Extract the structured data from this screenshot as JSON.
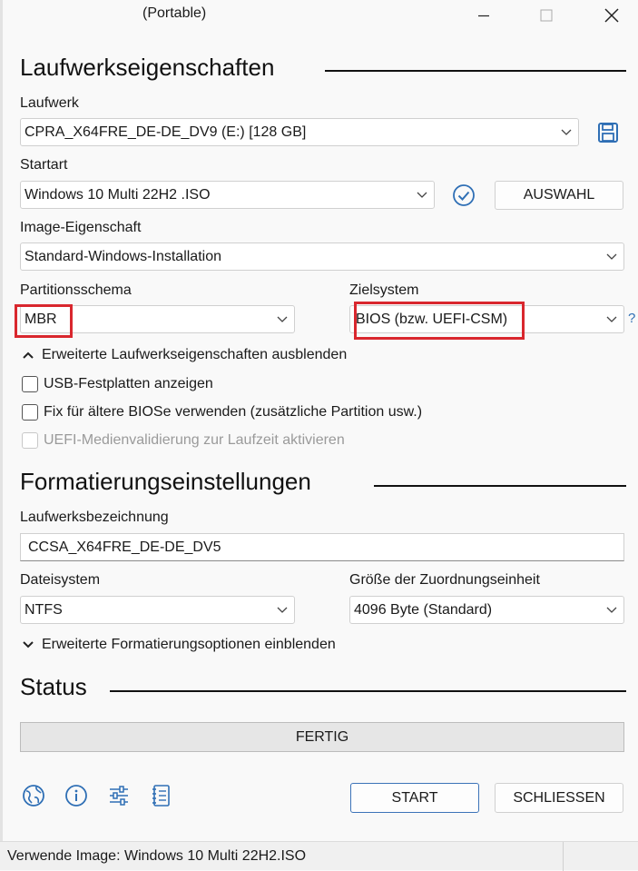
{
  "window": {
    "title": "(Portable)"
  },
  "drive_properties": {
    "heading": "Laufwerkseigenschaften",
    "device_label": "Laufwerk",
    "device_value": "CPRA_X64FRE_DE-DE_DV9 (E:) [128 GB]",
    "boot_label": "Startart",
    "boot_value": "Windows 10 Multi 22H2 .ISO",
    "select_button": "AUSWAHL",
    "image_option_label": "Image-Eigenschaft",
    "image_option_value": "Standard-Windows-Installation",
    "partition_label": "Partitionsschema",
    "partition_value": "MBR",
    "target_label": "Zielsystem",
    "target_value": "BIOS (bzw. UEFI-CSM)",
    "help_glyph": "?",
    "advanced_toggle": "Erweiterte Laufwerkseigenschaften ausblenden",
    "options": [
      {
        "label": "USB-Festplatten anzeigen",
        "checked": false,
        "enabled": true
      },
      {
        "label": "Fix für ältere BIOSe verwenden (zusätzliche Partition usw.)",
        "checked": false,
        "enabled": true
      },
      {
        "label": "UEFI-Medienvalidierung zur Laufzeit aktivieren",
        "checked": false,
        "enabled": false
      }
    ]
  },
  "format_options": {
    "heading": "Formatierungseinstellungen",
    "volume_label": "Laufwerksbezeichnung",
    "volume_value": "CCSA_X64FRE_DE-DE_DV5",
    "filesystem_label": "Dateisystem",
    "filesystem_value": "NTFS",
    "cluster_label": "Größe der Zuordnungseinheit",
    "cluster_value": "4096 Byte (Standard)",
    "advanced_toggle": "Erweiterte Formatierungsoptionen einblenden"
  },
  "status": {
    "heading": "Status",
    "progress_text": "FERTIG",
    "progress_fraction": 0
  },
  "footer": {
    "start_button": "START",
    "close_button": "SCHLIESSEN",
    "icons": [
      "globe-icon",
      "info-icon",
      "settings-sliders-icon",
      "log-icon"
    ]
  },
  "statusbar": {
    "text": "Verwende Image: Windows 10 Multi 22H2.ISO"
  },
  "colors": {
    "highlight": "#d9272e",
    "accent": "#2f6fb5",
    "primary_border": "#3c73b8"
  }
}
